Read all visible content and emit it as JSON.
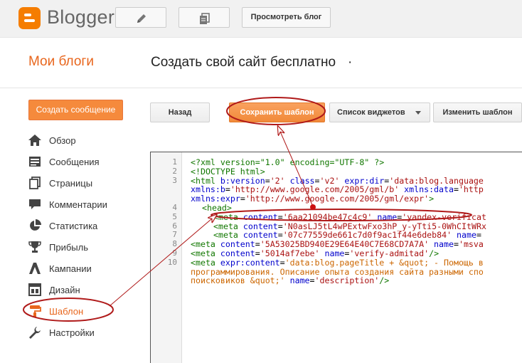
{
  "topbar": {
    "logo_text": "Blogger",
    "view_blog_label": "Просмотреть блог",
    "pencil_icon": "pencil-icon",
    "pages_icon": "pages-icon"
  },
  "header": {
    "my_blogs": "Мои блоги",
    "blog_name": "Создать свой сайт бесплатно",
    "dot": "·"
  },
  "create_post_label": "Создать сообщение",
  "sidebar": {
    "items": [
      {
        "label": "Обзор",
        "icon": "home-icon"
      },
      {
        "label": "Сообщения",
        "icon": "posts-icon"
      },
      {
        "label": "Страницы",
        "icon": "pages-icon"
      },
      {
        "label": "Комментарии",
        "icon": "comment-icon"
      },
      {
        "label": "Статистика",
        "icon": "pie-chart-icon"
      },
      {
        "label": "Прибыль",
        "icon": "trophy-icon"
      },
      {
        "label": "Кампании",
        "icon": "campaign-icon"
      },
      {
        "label": "Дизайн",
        "icon": "layout-icon"
      },
      {
        "label": "Шаблон",
        "icon": "paint-roller-icon"
      },
      {
        "label": "Настройки",
        "icon": "wrench-icon"
      }
    ],
    "active": "Шаблон"
  },
  "toolbar": {
    "back": "Назад",
    "save": "Сохранить шаблон",
    "widgets": "Список виджетов",
    "edit_template": "Изменить шаблон"
  },
  "editor": {
    "line_numbers": [
      "1",
      "2",
      "3",
      "4",
      "5",
      "6",
      "7",
      "8",
      "9",
      "10"
    ],
    "l1": "<?xml version=\"1.0\" encoding=\"UTF-8\" ?>",
    "l2": "<!DOCTYPE html>",
    "l3a": "<html ",
    "l3b": "b:version",
    "l3c": "=",
    "l3d": "'2'",
    "l3e": " class",
    "l3f": "=",
    "l3g": "'v2'",
    "l3h": " expr:dir",
    "l3i": "=",
    "l3j": "'data:blog.language",
    "l3k": "xmlns:b",
    "l3l": "=",
    "l3m": "'http://www.google.com/2005/gml/b'",
    "l3n": " xmlns:data",
    "l3o": "=",
    "l3p": "'http",
    "l3q": "xmlns:expr",
    "l3r": "=",
    "l3s": "'http://www.google.com/2005/gml/expr'",
    "l3t": ">",
    "l4": "<head>",
    "l5a": "<meta ",
    "l5b": "content",
    "l5c": "=",
    "l5d": "'6aa21094be47c4c9'",
    "l5e": " name",
    "l5f": "=",
    "l5g": "'yandex-verificat",
    "l6a": "<meta ",
    "l6b": "content",
    "l6c": "=",
    "l6d": "'N0asLJ5tL4wPExtwFxo3hP_y-yTti5-0WhCItWRx",
    "l7a": "<meta ",
    "l7b": "content",
    "l7c": "=",
    "l7d": "'07c77559de661c7d0f9ac1f44e6deb84'",
    "l7e": " name",
    "l7f": "=",
    "l8a": "<meta ",
    "l8b": "content",
    "l8c": "=",
    "l8d": "'5A53025BD940E29E64E40C7E68CD7A7A'",
    "l8e": " name",
    "l8f": "=",
    "l8g": "'msva",
    "l9a": "<meta ",
    "l9b": "content",
    "l9c": "=",
    "l9d": "'5014af7ebe'",
    "l9e": " name",
    "l9f": "=",
    "l9g": "'verify-admitad'",
    "l9h": "/>",
    "l10a": "<meta ",
    "l10b": "expr:content",
    "l10c": "=",
    "l10d": "'data:blog.pageTitle + &quot; - Помощь в",
    "l10e": "программирования. Описание опыта создания сайта разными спо",
    "l10f": "поисковиков &quot;'",
    "l10g": " name",
    "l10h": "=",
    "l10i": "'description'",
    "l10j": "/>"
  },
  "colors": {
    "accent": "#f57d00",
    "active_nav": "#e8661d",
    "annotation": "#b01a1a"
  }
}
